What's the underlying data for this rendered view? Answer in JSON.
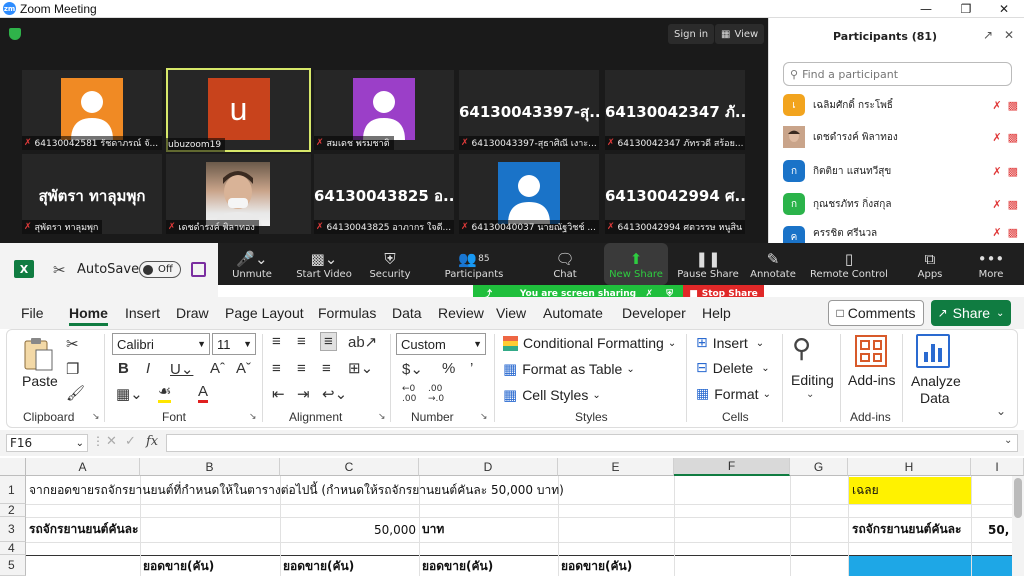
{
  "zoom": {
    "window_title": "Zoom Meeting",
    "sign_in": "Sign in",
    "view": "View",
    "tiles": [
      {
        "caption": "64130042581 รัชดาภรณ์ จั...",
        "avatar_color": "#f08a24",
        "type": "person",
        "muted": true
      },
      {
        "caption": "ubuzoom19",
        "avatar_letter": "u",
        "avatar_color": "#c8431c",
        "type": "letter",
        "muted": false
      },
      {
        "caption": "สมเดช พรมชาติ",
        "avatar_color": "#9b3fc8",
        "type": "person",
        "muted": true
      },
      {
        "caption": "64130043397-สุธาศิณี เงาะ...",
        "display_name": "64130043397-สุ...",
        "type": "name",
        "muted": true
      },
      {
        "caption": "64130042347 ภัทรวดี สร้อย...",
        "display_name": "64130042347 ภั...",
        "type": "name",
        "muted": true
      },
      {
        "caption": "สุพัตรา ทาลุมพุก",
        "display_name": "สุพัตรา ทาลุมพุก",
        "type": "name",
        "muted": true
      },
      {
        "caption": "เดชดำรงค์ พิลาทอง",
        "type": "photo",
        "muted": true
      },
      {
        "caption": "64130043825 อาภากร ใจดี...",
        "display_name": "64130043825 อ...",
        "type": "name",
        "muted": true
      },
      {
        "caption": "64130040037 นายณัฐวิชช์ ...",
        "avatar_color": "#1a73c8",
        "type": "person",
        "muted": true
      },
      {
        "caption": "64130042994 ศตวรรษ หนูสิน",
        "display_name": "64130042994 ศ...",
        "type": "name",
        "muted": true
      }
    ],
    "participants": {
      "title": "Participants (81)",
      "search_placeholder": "Find a participant",
      "list": [
        {
          "name": "เฉลิมศักดิ์ กระโพธิ์",
          "initial": "เ",
          "color": "#f2a41e"
        },
        {
          "name": "เดชดำรงค์ พิลาทอง",
          "initial": "",
          "color": "#8a6a50"
        },
        {
          "name": "กิตติยา แสนทวีสุข",
          "initial": "ก",
          "color": "#1a73c8"
        },
        {
          "name": "กุณชรภัทร กิ่งสกุล",
          "initial": "ก",
          "color": "#2bb34a"
        },
        {
          "name": "ครรชิต ศรีนวล",
          "initial": "ค",
          "color": "#1a73c8"
        }
      ]
    },
    "toolbar": {
      "unmute": "Unmute",
      "start_video": "Start Video",
      "security": "Security",
      "participants": "Participants",
      "participants_count": "85",
      "chat": "Chat",
      "new_share": "New Share",
      "pause_share": "Pause Share",
      "annotate": "Annotate",
      "remote_control": "Remote Control",
      "apps": "Apps",
      "more": "More"
    },
    "sharing_banner": "You are screen sharing",
    "stop_share": "Stop Share"
  },
  "excel": {
    "autosave": "AutoSave",
    "toggle": "Off",
    "menu": [
      "File",
      "Home",
      "Insert",
      "Draw",
      "Page Layout",
      "Formulas",
      "Data",
      "Review",
      "View",
      "Automate",
      "Developer",
      "Help"
    ],
    "comments": "Comments",
    "share": "Share",
    "ribbon": {
      "paste": "Paste",
      "clipboard": "Clipboard",
      "font_name": "Calibri",
      "font_size": "11",
      "font": "Font",
      "alignment": "Alignment",
      "number_format": "Custom",
      "number": "Number",
      "conditional_formatting": "Conditional Formatting",
      "format_as_table": "Format as Table",
      "cell_styles": "Cell Styles",
      "styles": "Styles",
      "insert": "Insert",
      "delete": "Delete",
      "format": "Format",
      "cells": "Cells",
      "editing": "Editing",
      "addins": "Add-ins",
      "addins_group": "Add-ins",
      "analyze": "Analyze",
      "analyze2": "Data"
    },
    "name_box": "F16",
    "columns": [
      "A",
      "B",
      "C",
      "D",
      "E",
      "F",
      "G",
      "H",
      "I"
    ],
    "rows": [
      "1",
      "2",
      "3",
      "4",
      "5"
    ],
    "cells": {
      "a1": "จากยอดขายรถจักรยานยนต์ที่กำหนดให้ในตารางต่อไปนี้ (กำหนดให้รถจักรยานยนต์คันละ 50,000 บาท)",
      "h1": "เฉลย",
      "a3": "รถจักรยานยนต์คันละ",
      "c3": "50,000",
      "d3": "บาท",
      "h3": "รถจักรยานยนต์คันละ",
      "i3": "50,",
      "b5": "ยอดขาย(คัน)",
      "c5": "ยอดขาย(คัน)",
      "d5": "ยอดขาย(คัน)",
      "e5": "ยอดขาย(คัน)"
    }
  }
}
